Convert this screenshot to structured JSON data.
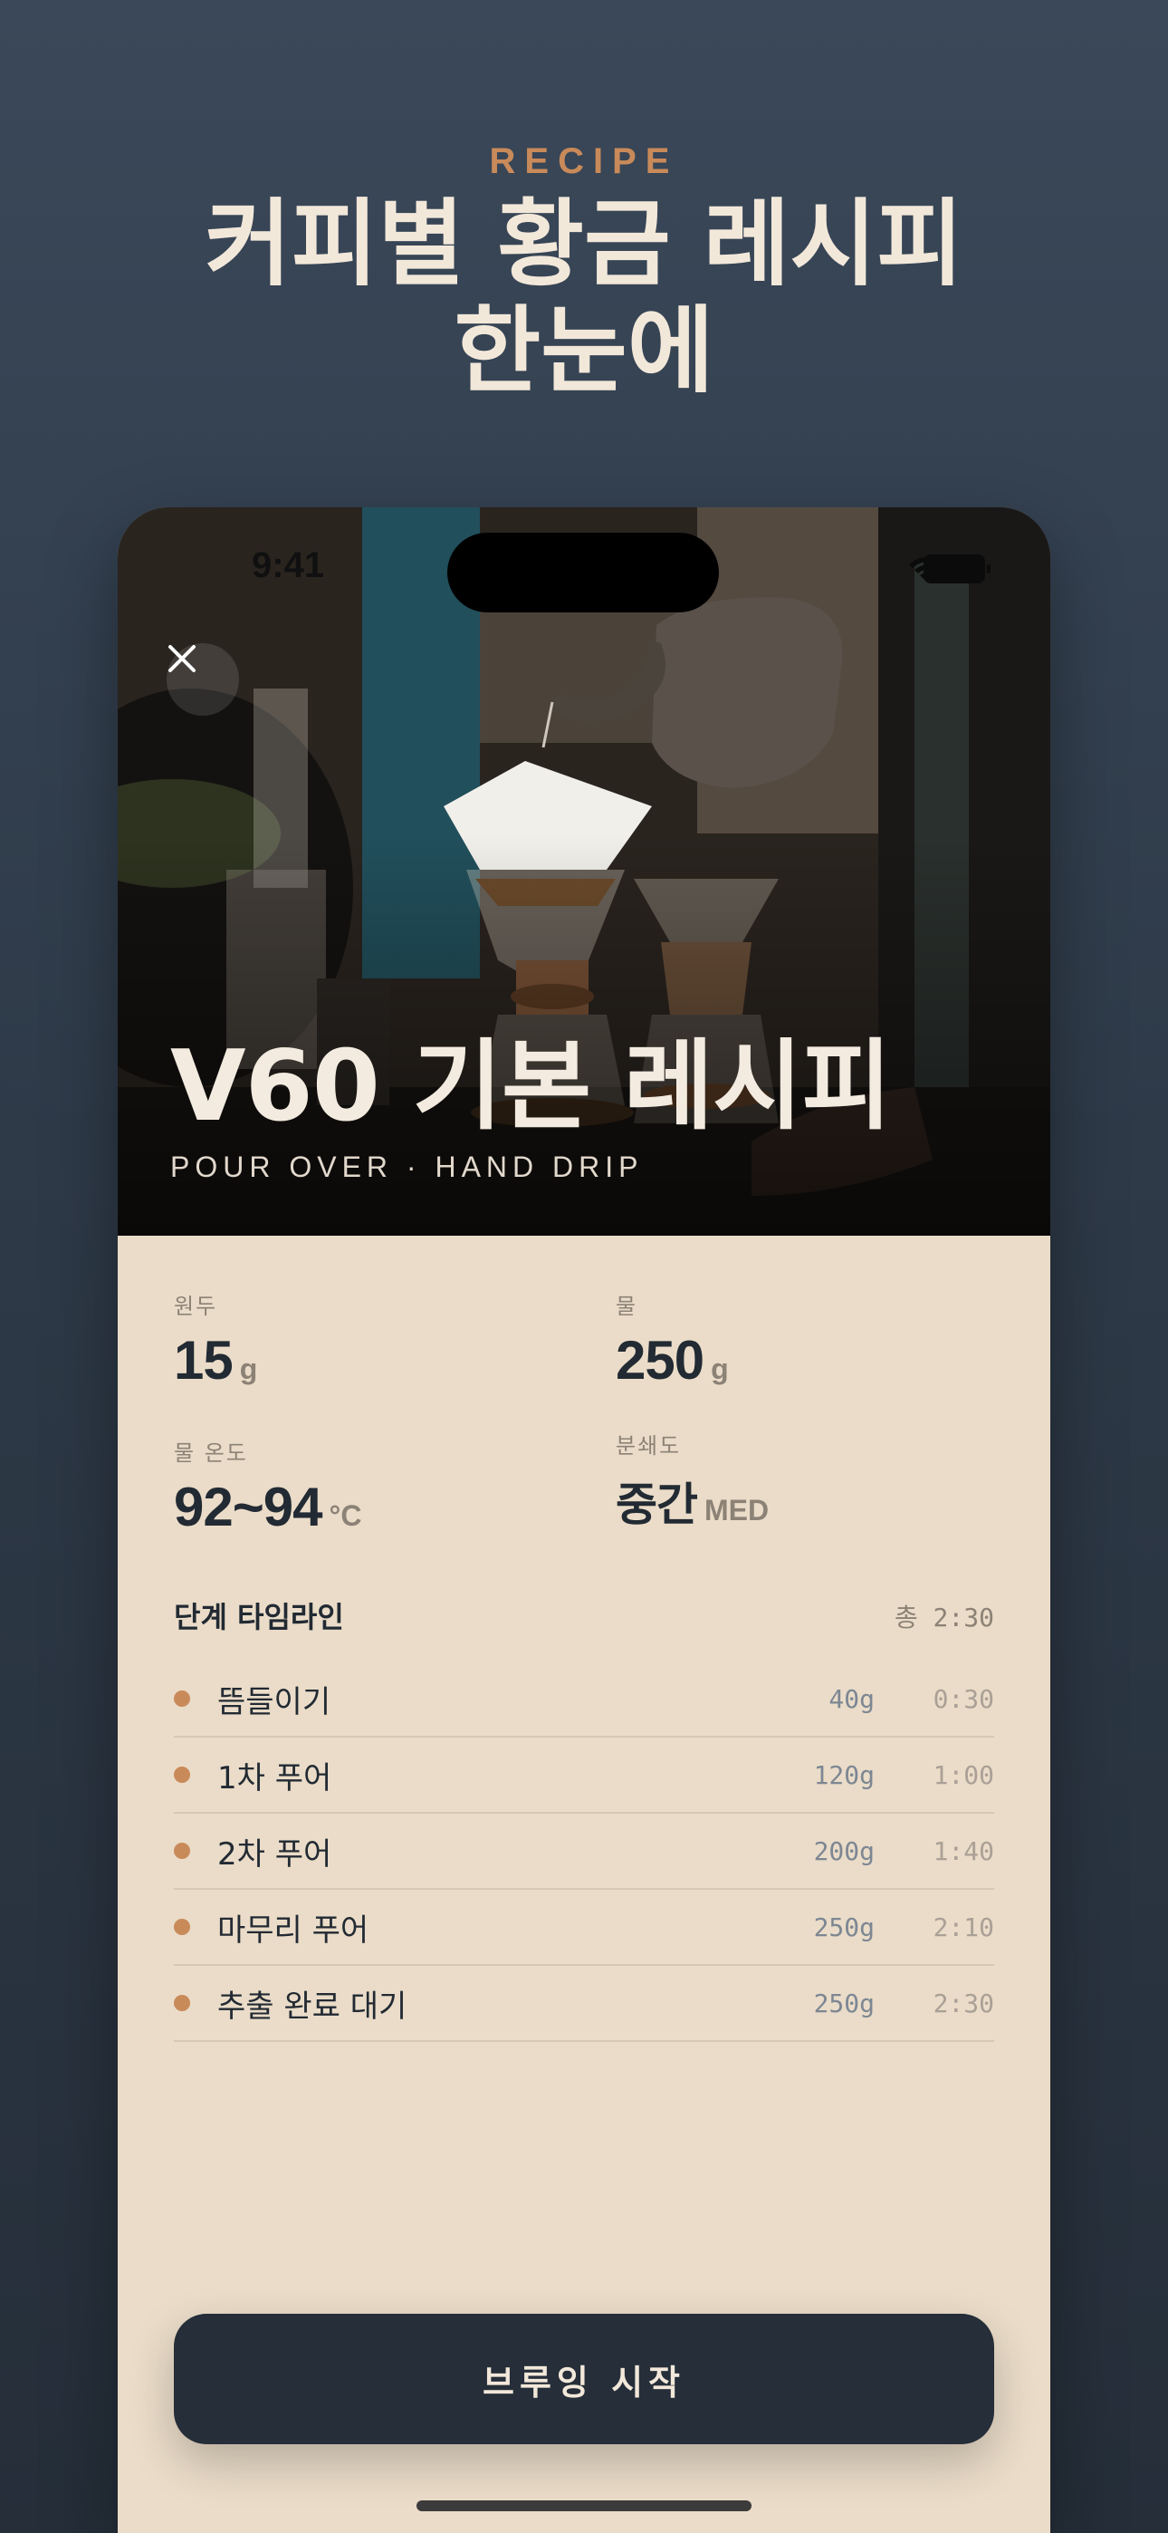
{
  "promo": {
    "eyebrow": "RECIPE",
    "headline_line1": "커피별 황금 레시피",
    "headline_line2": "한눈에"
  },
  "status_bar": {
    "time": "9:41"
  },
  "hero": {
    "title": "V60 기본 레시피",
    "subtitle": "POUR OVER · HAND DRIP"
  },
  "stats": {
    "beans": {
      "label": "원두",
      "value": "15",
      "unit": "g"
    },
    "water": {
      "label": "물",
      "value": "250",
      "unit": "g"
    },
    "temp": {
      "label": "물 온도",
      "value": "92~94",
      "unit": "°C"
    },
    "grind": {
      "label": "분쇄도",
      "value": "중간",
      "unit": "MED"
    }
  },
  "timeline": {
    "title": "단계 타임라인",
    "total": "총 2:30",
    "steps": [
      {
        "name": "뜸들이기",
        "amount": "40g",
        "time": "0:30"
      },
      {
        "name": "1차 푸어",
        "amount": "120g",
        "time": "1:00"
      },
      {
        "name": "2차 푸어",
        "amount": "200g",
        "time": "1:40"
      },
      {
        "name": "마무리 푸어",
        "amount": "250g",
        "time": "2:10"
      },
      {
        "name": "추출 완료 대기",
        "amount": "250g",
        "time": "2:30"
      }
    ]
  },
  "cta": {
    "label": "브루잉 시작"
  },
  "colors": {
    "accent": "#c98a5a",
    "background": "#2e3a48",
    "card": "#eadcc8",
    "dark": "#252e39"
  },
  "icons": [
    "close-icon",
    "wifi-icon",
    "battery-icon"
  ]
}
